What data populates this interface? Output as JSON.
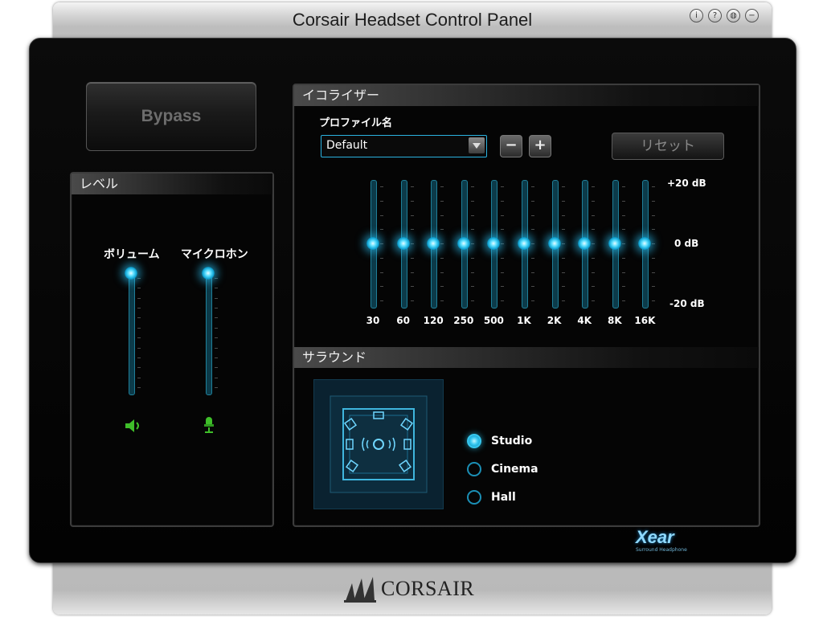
{
  "window": {
    "title": "Corsair Headset Control Panel",
    "title_buttons": [
      "info-icon",
      "help-icon",
      "language-icon",
      "minimize-icon"
    ]
  },
  "bypass": {
    "label": "Bypass"
  },
  "level": {
    "heading": "レベル",
    "volume": {
      "label": "ボリューム",
      "icon": "speaker-icon",
      "value": 1.0
    },
    "microphone": {
      "label": "マイクロホン",
      "icon": "microphone-icon",
      "value": 1.0
    }
  },
  "equalizer": {
    "heading": "イコライザー",
    "profile_label": "プロファイル名",
    "profile_value": "Default",
    "minus_label": "−",
    "plus_label": "+",
    "reset_label": "リセット",
    "db_labels": {
      "top": "+20 dB",
      "mid": "0 dB",
      "bottom": "-20 dB"
    },
    "bands": [
      {
        "freq": "30",
        "gain_db": 0
      },
      {
        "freq": "60",
        "gain_db": 0
      },
      {
        "freq": "120",
        "gain_db": 0
      },
      {
        "freq": "250",
        "gain_db": 0
      },
      {
        "freq": "500",
        "gain_db": 0
      },
      {
        "freq": "1K",
        "gain_db": 0
      },
      {
        "freq": "2K",
        "gain_db": 0
      },
      {
        "freq": "4K",
        "gain_db": 0
      },
      {
        "freq": "8K",
        "gain_db": 0
      },
      {
        "freq": "16K",
        "gain_db": 0
      }
    ]
  },
  "surround": {
    "heading": "サラウンド",
    "options": [
      {
        "label": "Studio",
        "selected": true
      },
      {
        "label": "Cinema",
        "selected": false
      },
      {
        "label": "Hall",
        "selected": false
      }
    ]
  },
  "footer": {
    "xear_logo": "Xear",
    "xear_sub": "Surround Headphone",
    "brand": "CORSAIR"
  },
  "colors": {
    "accent": "#2ab2e0",
    "glow": "#5fe0ff",
    "icon_green": "#3fbf2a"
  }
}
